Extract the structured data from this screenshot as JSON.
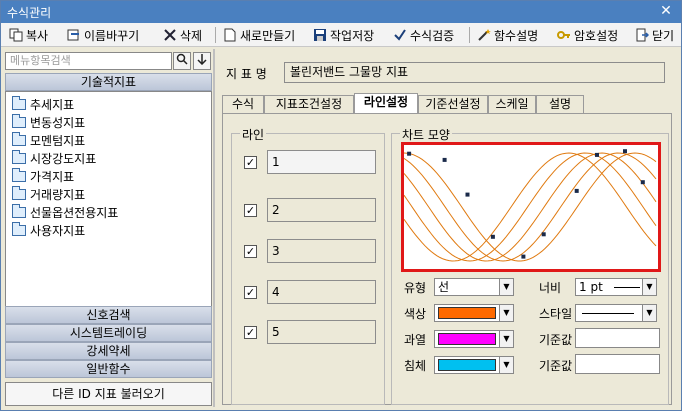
{
  "window": {
    "title": "수식관리",
    "close_glyph": "✕"
  },
  "toolbar": {
    "copy": "복사",
    "rename": "이름바꾸기",
    "delete": "삭제",
    "new": "새로만들기",
    "save": "작업저장",
    "verify": "수식검증",
    "funcdesc": "함수설명",
    "password": "암호설정",
    "close": "닫기"
  },
  "left": {
    "search_placeholder": "메뉴항목검색",
    "category_top": "기술적지표",
    "tree": [
      "추세지표",
      "변동성지표",
      "모멘텀지표",
      "시장강도지표",
      "가격지표",
      "거래량지표",
      "선물옵션전용지표",
      "사용자지표"
    ],
    "categories_bottom": [
      "신호검색",
      "시스템트레이딩",
      "강세약세",
      "일반함수"
    ],
    "load_button": "다른 ID 지표 불러오기"
  },
  "right": {
    "name_label": "지 표 명",
    "name_value": "볼린저밴드 그물망 지표",
    "tabs": [
      "수식",
      "지표조건설정",
      "라인설정",
      "기준선설정",
      "스케일",
      "설명"
    ],
    "active_tab": "라인설정",
    "line_group_label": "라인",
    "lines": [
      "1",
      "2",
      "3",
      "4",
      "5"
    ],
    "chart_group_label": "차트 모양",
    "props": {
      "type_label": "유형",
      "type_value": "선",
      "width_label": "너비",
      "width_value": "1 pt",
      "color_label": "색상",
      "color_value": "#ff6a00",
      "style_label": "스타일",
      "over_label": "과열",
      "over_value": "#ff00ff",
      "base_label1": "기준값",
      "sink_label": "침체",
      "sink_value": "#00c0f0",
      "base_label2": "기준값"
    }
  },
  "chart_data": {
    "type": "line",
    "series_count": 5,
    "color": "#e07a10",
    "style": "sine-waves-preview"
  }
}
